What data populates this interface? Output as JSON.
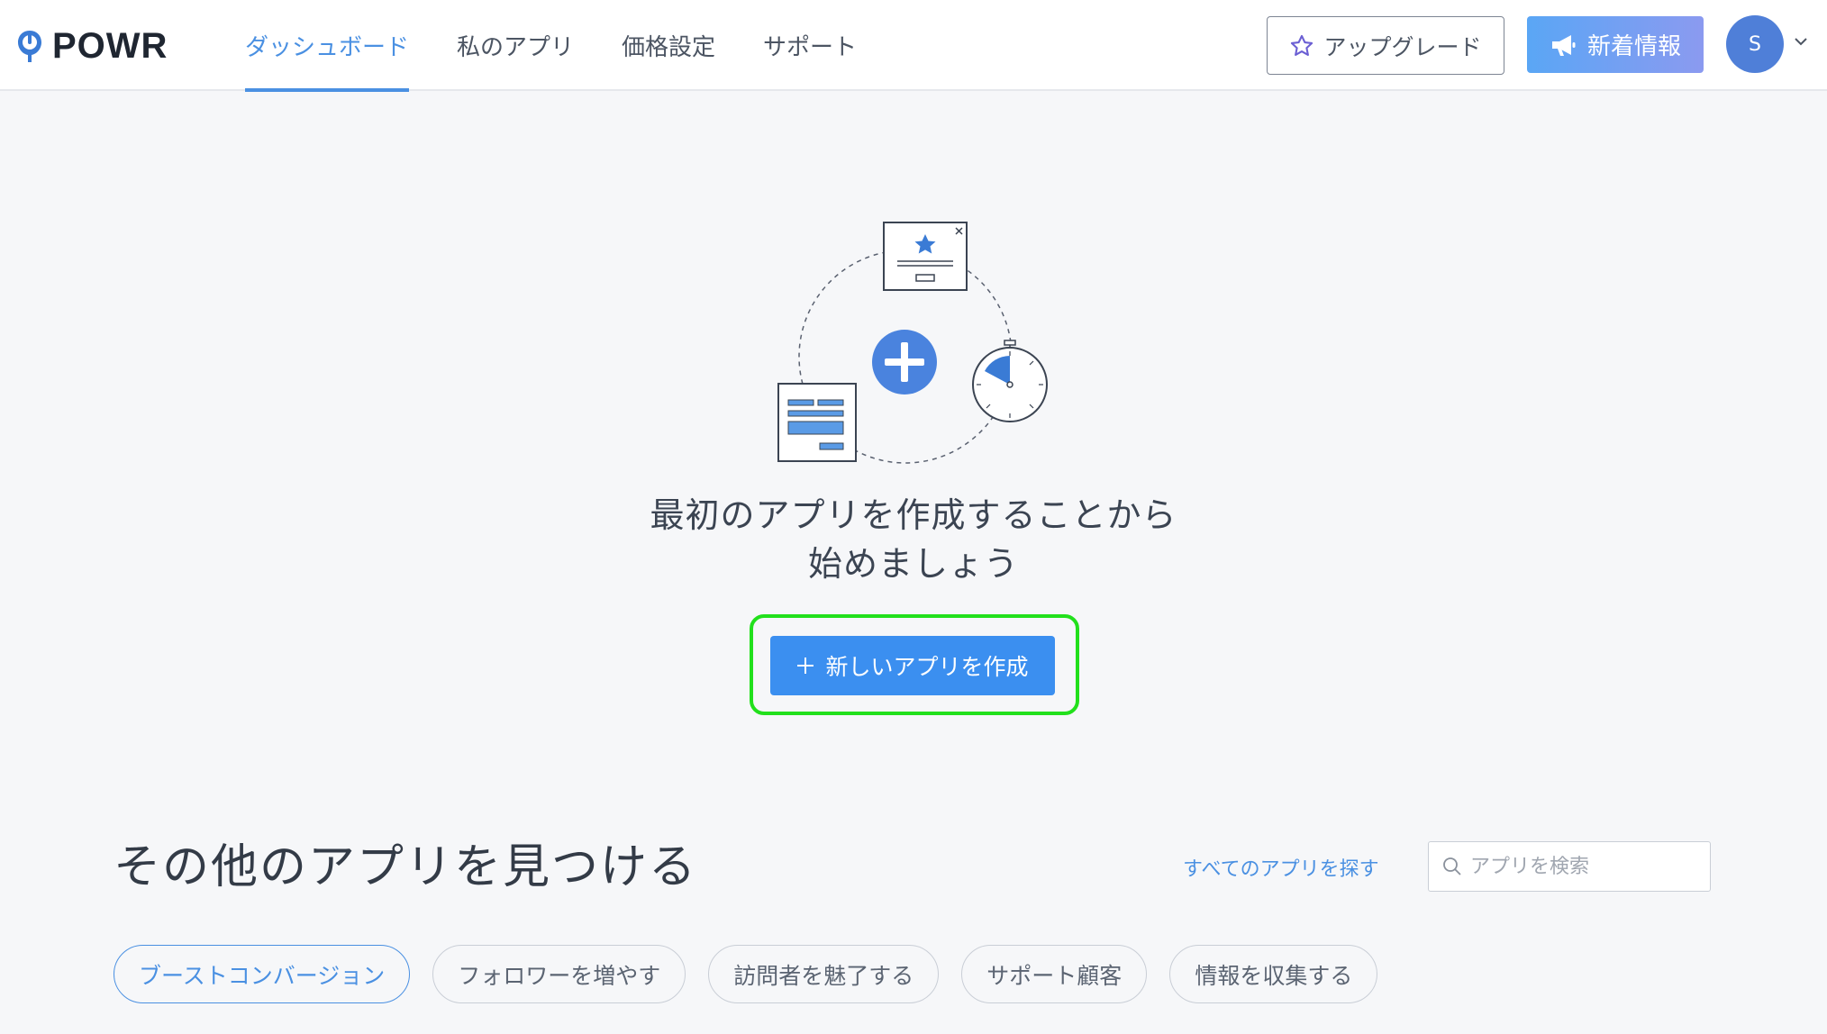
{
  "brand": {
    "name": "POWR",
    "logo_icon": "powr-power-icon"
  },
  "nav": {
    "items": [
      {
        "label": "ダッシュボード",
        "active": true
      },
      {
        "label": "私のアプリ",
        "active": false
      },
      {
        "label": "価格設定",
        "active": false
      },
      {
        "label": "サポート",
        "active": false
      }
    ]
  },
  "header": {
    "upgrade_label": "アップグレード",
    "upgrade_icon": "star-outline-icon",
    "news_label": "新着情報",
    "news_icon": "megaphone-icon",
    "avatar_initial": "S"
  },
  "hero": {
    "title_line1": "最初のアプリを作成することから",
    "title_line2": "始めましょう",
    "create_button_label": "新しいアプリを作成",
    "create_button_icon": "plus-icon"
  },
  "discover": {
    "title": "その他のアプリを見つける",
    "browse_link": "すべてのアプリを探す",
    "search_placeholder": "アプリを検索",
    "categories": [
      {
        "label": "ブーストコンバージョン",
        "active": true
      },
      {
        "label": "フォロワーを増やす",
        "active": false
      },
      {
        "label": "訪問者を魅了する",
        "active": false
      },
      {
        "label": "サポート顧客",
        "active": false
      },
      {
        "label": "情報を収集する",
        "active": false
      }
    ]
  },
  "colors": {
    "accent": "#4a90e2",
    "primary_button": "#3b8ff0",
    "highlight_outline": "#22e01c",
    "news_gradient_start": "#5aa6f5",
    "news_gradient_end": "#8b9af0",
    "avatar_bg": "#4f7fd8"
  }
}
